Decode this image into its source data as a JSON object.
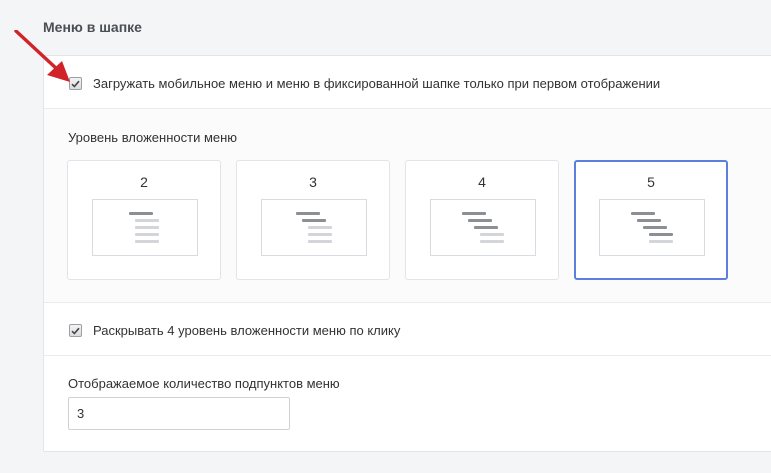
{
  "section": {
    "title": "Меню в шапке"
  },
  "options": {
    "load_menu_first": {
      "label": "Загружать мобильное меню и меню в фиксированной шапке только при первом отображении",
      "checked": true
    },
    "expand_level4": {
      "label": "Раскрывать 4 уровень вложенности меню по клику",
      "checked": true
    }
  },
  "nesting": {
    "label": "Уровень вложенности меню",
    "levels": [
      {
        "value": "2",
        "selected": false
      },
      {
        "value": "3",
        "selected": false
      },
      {
        "value": "4",
        "selected": false
      },
      {
        "value": "5",
        "selected": true
      }
    ]
  },
  "subitems": {
    "label": "Отображаемое количество подпунктов меню",
    "value": "3"
  },
  "colors": {
    "accent": "#5b7fdc",
    "annotation_arrow": "#d0242a"
  },
  "icons": {
    "checkbox": "checkmark-icon",
    "annotation": "red-arrow-icon"
  }
}
